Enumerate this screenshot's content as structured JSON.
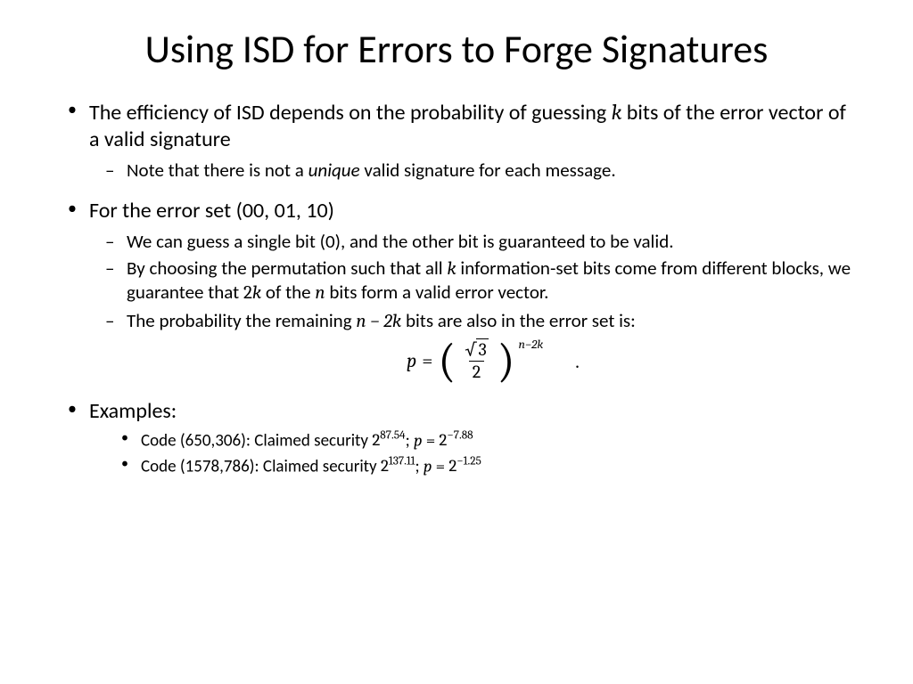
{
  "title": "Using ISD for Errors to Forge Signatures",
  "bullets": {
    "b1": {
      "text_pre": "The efficiency of ISD depends on the probability of guessing ",
      "var": "k",
      "text_post": " bits of the error vector of a valid signature",
      "sub1_pre": "Note that there is not a ",
      "sub1_italic": "unique",
      "sub1_post": " valid signature for each message."
    },
    "b2": {
      "text": "For the error set (00, 01, 10)",
      "sub1": "We can guess a single bit (0), and the other bit is guaranteed to be valid.",
      "sub2_pre": "By choosing the permutation such that all ",
      "sub2_k": "k",
      "sub2_mid": "  information-set bits come from different blocks, we guarantee that ",
      "sub2_2k": "2k",
      "sub2_mid2": " of the ",
      "sub2_n": "n",
      "sub2_post": " bits form a valid error vector.",
      "sub3_pre": "The probability the remaining ",
      "sub3_expr": "n − 2k",
      "sub3_post": " bits are also in the error set is:"
    },
    "formula": {
      "p": "p",
      "eq": " = ",
      "sqrt_radicand": "3",
      "denom": "2",
      "exp": "n−2k",
      "period": "."
    },
    "b3": {
      "text": "Examples:",
      "ex1_pre": "Code (650,306): Claimed security ",
      "ex1_base1": "2",
      "ex1_exp1": "87.54",
      "ex1_sep": "; ",
      "ex1_p": "p",
      "ex1_eq": " = ",
      "ex1_base2": "2",
      "ex1_exp2": "−7.88",
      "ex2_pre": "Code (1578,786): Claimed security ",
      "ex2_base1": "2",
      "ex2_exp1": "137.11",
      "ex2_sep": "; ",
      "ex2_p": "p",
      "ex2_eq": " = ",
      "ex2_base2": "2",
      "ex2_exp2": "−1.25"
    }
  }
}
